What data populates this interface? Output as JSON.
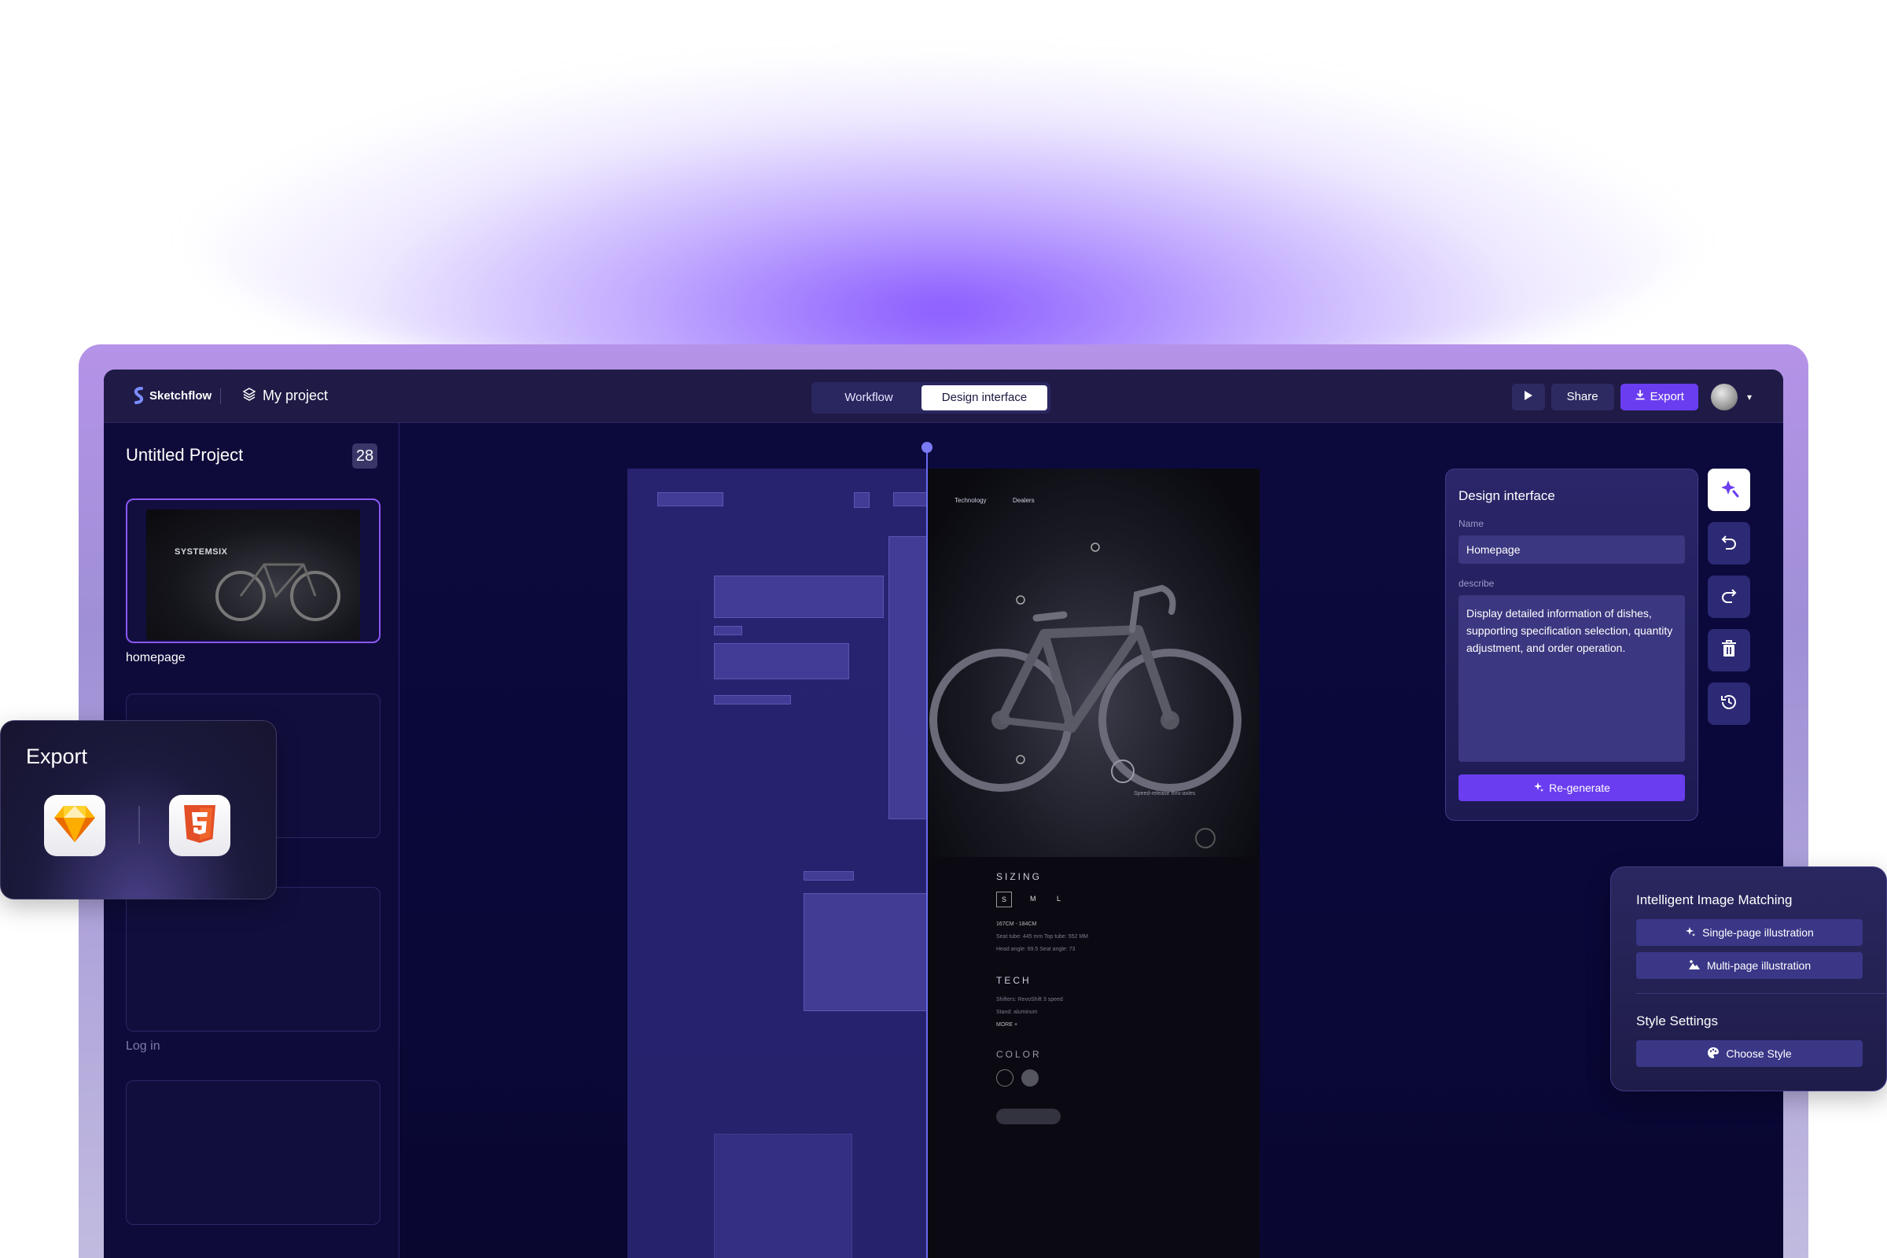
{
  "app": {
    "logo_text": "Sketchflow",
    "project_name": "My project"
  },
  "tabs": [
    {
      "label": "Workflow"
    },
    {
      "label": "Design interface"
    }
  ],
  "toolbar": {
    "share_label": "Share",
    "export_label": "Export"
  },
  "sidebar": {
    "project_title": "Untitled Project",
    "page_count": "28",
    "pages": [
      {
        "label": "homepage",
        "thumb_title": "SYSTEMSIX"
      },
      {
        "label": ""
      },
      {
        "label": "Log in"
      },
      {
        "label": ""
      }
    ]
  },
  "canvas": {
    "nav_items": [
      "Technology",
      "Dealers"
    ],
    "callout": "Speed-release thru-axles",
    "sizing_heading": "SIZING",
    "sizes": [
      "S",
      "M",
      "L"
    ],
    "size_range": "167CM - 184CM",
    "size_specs_1": "Seat tube: 445 mm   Top tube: 552 MM",
    "size_specs_2": "Head angle: 69.5   Seat angle: 73",
    "tech_heading": "TECH",
    "tech_1": "Shifters: RevoShift 3 speed",
    "tech_2": "Stand: aluminum",
    "tech_more": "MORE +",
    "color_heading": "COLOR"
  },
  "design_panel": {
    "title": "Design interface",
    "name_label": "Name",
    "name_value": "Homepage",
    "describe_label": "describe",
    "describe_value": "Display detailed information of dishes, supporting specification selection, quantity adjustment, and order operation.",
    "regenerate_label": "Re-generate"
  },
  "side_tools": [
    "magic-icon",
    "undo-icon",
    "redo-icon",
    "trash-icon",
    "history-icon"
  ],
  "export_popup": {
    "title": "Export",
    "apps": [
      "sketch-icon",
      "html5-icon"
    ]
  },
  "image_popup": {
    "title": "Intelligent Image Matching",
    "single_label": "Single-page illustration",
    "multi_label": "Multi-page illustration",
    "style_title": "Style Settings",
    "choose_style_label": "Choose Style"
  },
  "colors": {
    "accent": "#6a3df0",
    "panel_bg": "#1f1b46",
    "canvas_bg": "#0d0a3d",
    "html5_orange": "#e34f26",
    "sketch_yellow": "#fdb300"
  }
}
